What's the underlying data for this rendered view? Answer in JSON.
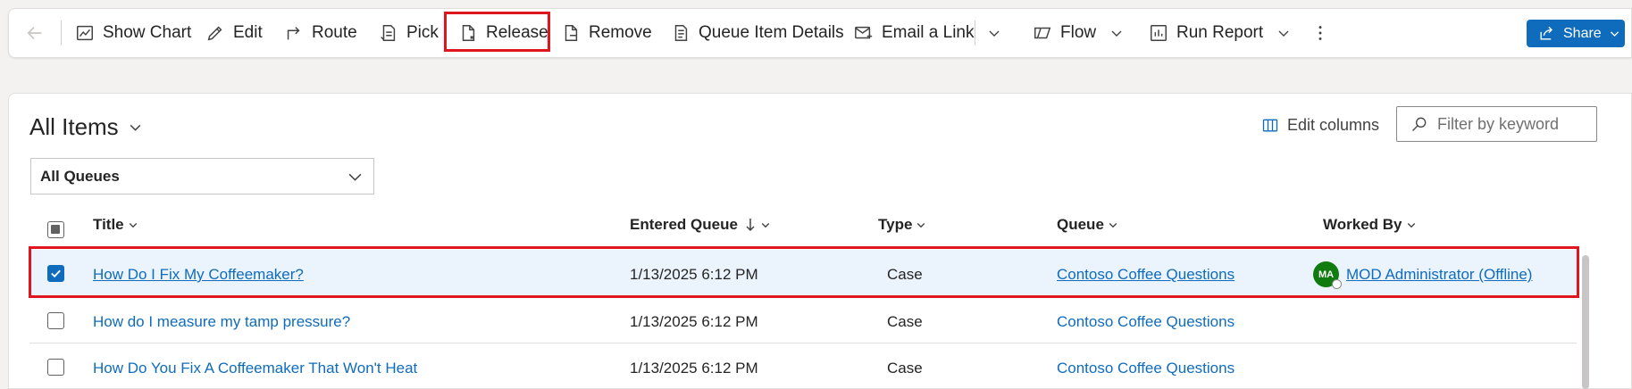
{
  "toolbar": {
    "show_chart": "Show Chart",
    "edit": "Edit",
    "route": "Route",
    "pick": "Pick",
    "release": "Release",
    "remove": "Remove",
    "queue_item_details": "Queue Item Details",
    "email_link": "Email a Link",
    "flow": "Flow",
    "run_report": "Run Report",
    "share": "Share"
  },
  "view": {
    "title": "All Items",
    "edit_columns": "Edit columns",
    "filter_placeholder": "Filter by keyword",
    "queue_filter": "All Queues"
  },
  "grid": {
    "columns": [
      "Title",
      "Entered Queue",
      "Type",
      "Queue",
      "Worked By"
    ],
    "rows": [
      {
        "title": "How Do I Fix My Coffeemaker?",
        "entered": "1/13/2025 6:12 PM",
        "type": "Case",
        "queue": "Contoso Coffee Questions",
        "worked_by": "MOD Administrator (Offline)",
        "avatar": "MA",
        "selected": true
      },
      {
        "title": "How do I measure my tamp pressure?",
        "entered": "1/13/2025 6:12 PM",
        "type": "Case",
        "queue": "Contoso Coffee Questions",
        "worked_by": "",
        "selected": false
      },
      {
        "title": "How Do You Fix A Coffeemaker That Won't Heat",
        "entered": "1/13/2025 6:12 PM",
        "type": "Case",
        "queue": "Contoso Coffee Questions",
        "worked_by": "",
        "selected": false
      }
    ]
  },
  "colors": {
    "accent": "#0f6cbd",
    "highlight": "#e0161e",
    "selected_row": "#ebf3fc",
    "avatar": "#107c10"
  }
}
